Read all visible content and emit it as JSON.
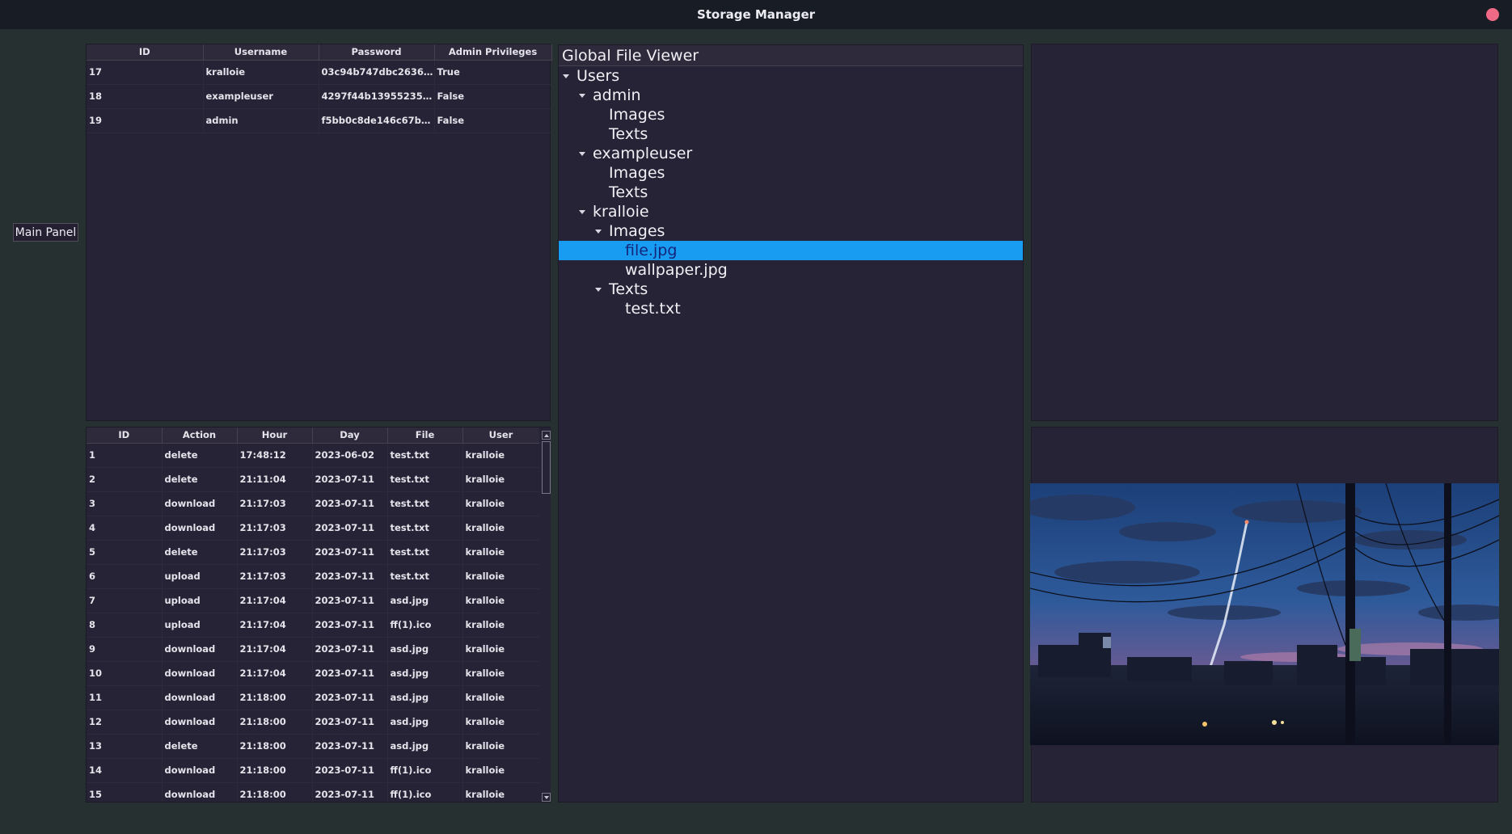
{
  "window": {
    "title": "Storage Manager"
  },
  "sidebar": {
    "main_panel_label": "Main Panel"
  },
  "users_table": {
    "columns": [
      "ID",
      "Username",
      "Password",
      "Admin Privileges"
    ],
    "rows": [
      [
        "17",
        "kralloie",
        "03c94b747dbc2636ee…",
        "True"
      ],
      [
        "18",
        "exampleuser",
        "4297f44b1395523524…",
        "False"
      ],
      [
        "19",
        "admin",
        "f5bb0c8de146c67b44…",
        "False"
      ]
    ]
  },
  "log_table": {
    "columns": [
      "ID",
      "Action",
      "Hour",
      "Day",
      "File",
      "User"
    ],
    "rows": [
      [
        "1",
        "delete",
        "17:48:12",
        "2023-06-02",
        "test.txt",
        "kralloie"
      ],
      [
        "2",
        "delete",
        "21:11:04",
        "2023-07-11",
        "test.txt",
        "kralloie"
      ],
      [
        "3",
        "download",
        "21:17:03",
        "2023-07-11",
        "test.txt",
        "kralloie"
      ],
      [
        "4",
        "download",
        "21:17:03",
        "2023-07-11",
        "test.txt",
        "kralloie"
      ],
      [
        "5",
        "delete",
        "21:17:03",
        "2023-07-11",
        "test.txt",
        "kralloie"
      ],
      [
        "6",
        "upload",
        "21:17:03",
        "2023-07-11",
        "test.txt",
        "kralloie"
      ],
      [
        "7",
        "upload",
        "21:17:04",
        "2023-07-11",
        "asd.jpg",
        "kralloie"
      ],
      [
        "8",
        "upload",
        "21:17:04",
        "2023-07-11",
        "ff(1).ico",
        "kralloie"
      ],
      [
        "9",
        "download",
        "21:17:04",
        "2023-07-11",
        "asd.jpg",
        "kralloie"
      ],
      [
        "10",
        "download",
        "21:17:04",
        "2023-07-11",
        "asd.jpg",
        "kralloie"
      ],
      [
        "11",
        "download",
        "21:18:00",
        "2023-07-11",
        "asd.jpg",
        "kralloie"
      ],
      [
        "12",
        "download",
        "21:18:00",
        "2023-07-11",
        "asd.jpg",
        "kralloie"
      ],
      [
        "13",
        "delete",
        "21:18:00",
        "2023-07-11",
        "asd.jpg",
        "kralloie"
      ],
      [
        "14",
        "download",
        "21:18:00",
        "2023-07-11",
        "ff(1).ico",
        "kralloie"
      ],
      [
        "15",
        "download",
        "21:18:00",
        "2023-07-11",
        "ff(1).ico",
        "kralloie"
      ]
    ]
  },
  "file_viewer": {
    "header": "Global File Viewer",
    "nodes": [
      {
        "label": "Users",
        "depth": 0,
        "expanded": true
      },
      {
        "label": "admin",
        "depth": 1,
        "expanded": true
      },
      {
        "label": "Images",
        "depth": 2,
        "expanded": false
      },
      {
        "label": "Texts",
        "depth": 2,
        "expanded": false
      },
      {
        "label": "exampleuser",
        "depth": 1,
        "expanded": true
      },
      {
        "label": "Images",
        "depth": 2,
        "expanded": false
      },
      {
        "label": "Texts",
        "depth": 2,
        "expanded": false
      },
      {
        "label": "kralloie",
        "depth": 1,
        "expanded": true
      },
      {
        "label": "Images",
        "depth": 2,
        "expanded": true
      },
      {
        "label": "file.jpg",
        "depth": 3,
        "expanded": false,
        "selected": true
      },
      {
        "label": "wallpaper.jpg",
        "depth": 3,
        "expanded": false
      },
      {
        "label": "Texts",
        "depth": 2,
        "expanded": true
      },
      {
        "label": "test.txt",
        "depth": 3,
        "expanded": false
      }
    ]
  },
  "preview": {
    "image_name": "landscape-image"
  },
  "colors": {
    "background": "#263030",
    "titlebar": "#181c24",
    "panel": "#262337",
    "selection": "#189cf2",
    "close_button": "#f06a87"
  }
}
